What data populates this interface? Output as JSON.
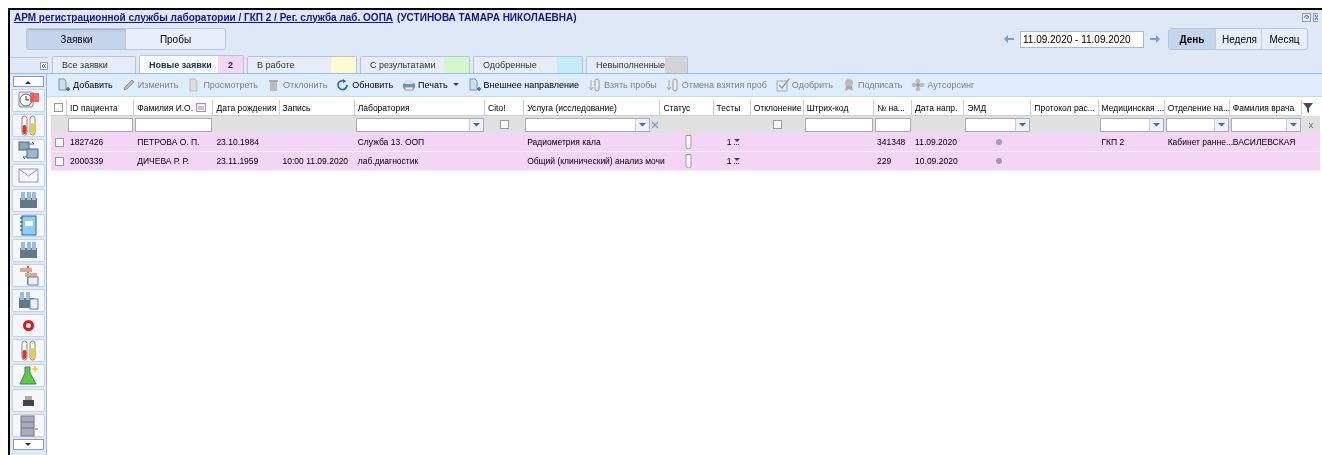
{
  "window": {
    "title_link": "АРМ регистрационной службы лаборатории / ГКП 2 / Рег. служба лаб. ООПА",
    "user": "(УСТИНОВА ТАМАРА НИКОЛАЕВНА)"
  },
  "modes": [
    {
      "label": "Заявки",
      "selected": true
    },
    {
      "label": "Пробы",
      "selected": false
    }
  ],
  "date_range": {
    "value": "11.09.2020 - 11.09.2020"
  },
  "periods": [
    {
      "label": "День",
      "selected": true
    },
    {
      "label": "Неделя",
      "selected": false
    },
    {
      "label": "Месяц",
      "selected": false
    }
  ],
  "tabs": [
    {
      "label": "Все заявки",
      "selected": false
    },
    {
      "label": "Новые заявки",
      "selected": true,
      "count": "2",
      "color": "#f5d6f5"
    },
    {
      "label": "В работе",
      "selected": false,
      "color": "#fcfcd0"
    },
    {
      "label": "С результатами",
      "selected": false,
      "color": "#d6f5c8"
    },
    {
      "label": "Одобренные",
      "selected": false,
      "color": "#c4ecf8"
    },
    {
      "label": "Невыполненные",
      "selected": false,
      "color": "#d4d4d4"
    }
  ],
  "toolbar": [
    {
      "label": "Добавить",
      "disabled": false,
      "menu": false
    },
    {
      "label": "Изменить",
      "disabled": true,
      "menu": false
    },
    {
      "label": "Просмотреть",
      "disabled": true,
      "menu": false
    },
    {
      "label": "Отклонить",
      "disabled": true,
      "menu": false
    },
    {
      "label": "Обновить",
      "disabled": false,
      "menu": false
    },
    {
      "label": "Печать",
      "disabled": false,
      "menu": true
    },
    {
      "label": "Внешнее направление",
      "disabled": false,
      "menu": false
    },
    {
      "label": "Взять пробы",
      "disabled": true,
      "menu": false
    },
    {
      "label": "Отмена взятия проб",
      "disabled": true,
      "menu": false
    },
    {
      "label": "Одобрить",
      "disabled": true,
      "menu": false
    },
    {
      "label": "Подписать",
      "disabled": true,
      "menu": false
    },
    {
      "label": "Аутсорсинг",
      "disabled": true,
      "menu": false
    }
  ],
  "table": {
    "select_all": false,
    "clear_filters": "x",
    "columns": [
      {
        "label": "ID пациента",
        "kind": "text"
      },
      {
        "label": "Фамилия И.О.",
        "kind": "text",
        "header_icon": true
      },
      {
        "label": "Дата рождения",
        "kind": "none"
      },
      {
        "label": "Запись",
        "kind": "none"
      },
      {
        "label": "Лаборатория",
        "kind": "combo"
      },
      {
        "label": "Cito!",
        "kind": "check",
        "filter_checked": false
      },
      {
        "label": "Услуга (исследование)",
        "kind": "combo_clear"
      },
      {
        "label": "Статус",
        "kind": "none"
      },
      {
        "label": "Тесты",
        "kind": "none"
      },
      {
        "label": "Отклонение",
        "kind": "check",
        "filter_checked": false
      },
      {
        "label": "Штрих-код",
        "kind": "text"
      },
      {
        "label": "№ на...",
        "kind": "text"
      },
      {
        "label": "Дата напр.",
        "kind": "none"
      },
      {
        "label": "ЭМД",
        "kind": "combo"
      },
      {
        "label": "Протокол рас...",
        "kind": "none"
      },
      {
        "label": "Медицинская ...",
        "kind": "combo"
      },
      {
        "label": "Отделение на...",
        "kind": "combo"
      },
      {
        "label": "Фамилия врача",
        "kind": "combo"
      }
    ],
    "rows": [
      {
        "checked": false,
        "patient_id": "1827426",
        "full_name": "ПЕТРОВА О. П.",
        "birth_date": "23.10.1984",
        "laboratory": "Служба 13. ООП",
        "service": "Радиометрия кала",
        "tests": "1",
        "referral_no": "341348",
        "referral_date": "11.09.2020",
        "medical_org": "ГКП 2",
        "department": "Кабинет ранне...",
        "doctor": "ВАСИЛЕВСКАЯ"
      },
      {
        "checked": false,
        "patient_id": "2000339",
        "full_name": "ДИЧЕВА Р. Р.",
        "birth_date": "23.11.1959",
        "record": "10:00 11.09.2020",
        "laboratory": "лаб.диагностик",
        "service": "Общий (клинический) анализ мочи",
        "tests": "1",
        "referral_no": "229",
        "referral_date": "10.09.2020"
      }
    ]
  }
}
